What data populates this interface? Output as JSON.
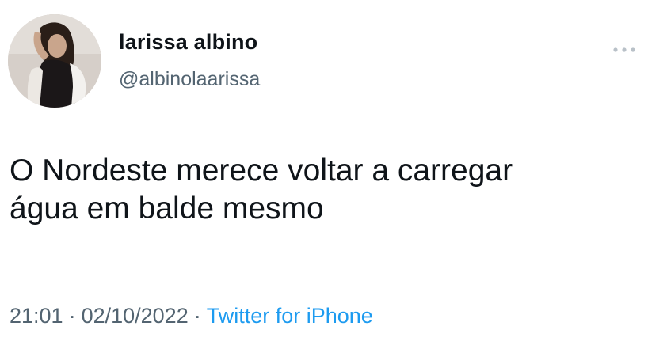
{
  "tweet": {
    "author": {
      "display_name": "larissa albino",
      "handle": "@albinolaarissa"
    },
    "text_lines": [
      "O Nordeste merece voltar a carregar",
      "água em balde mesmo"
    ],
    "time": "21:01",
    "date": "02/10/2022",
    "separator": "·",
    "source": "Twitter for iPhone"
  },
  "icons": {
    "more": "more-options-icon",
    "avatar": "profile-photo"
  },
  "colors": {
    "text": "#0f1419",
    "secondary": "#536471",
    "link": "#1d9bf0",
    "divider": "#e4e8eb"
  }
}
